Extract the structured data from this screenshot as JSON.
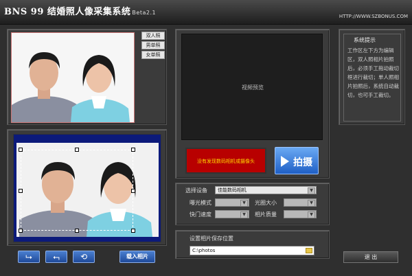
{
  "app": {
    "title": "BNS 99 结婚照人像采集系统",
    "version": "Beta2.1",
    "url": "HTTP://WWW.SZBONUS.COM"
  },
  "photo_tabs": [
    "双人照",
    "男单照",
    "女单照"
  ],
  "video": {
    "preview_label": "视频预览",
    "warning": "没有发现数码相机或摄像头",
    "shoot_label": "拍摄"
  },
  "settings": {
    "device_label": "选择设备",
    "device_value": "佳能数码相机",
    "exposure_label": "曝光模式",
    "aperture_label": "光圈大小",
    "shutter_label": "快门速度",
    "quality_label": "相片质量"
  },
  "save": {
    "label": "设置相片保存位置",
    "path": "C:\\photos"
  },
  "tips": {
    "title": "系统提示",
    "text": "工作区左下方为编辑区，双人照相片拍照后，必须手工拖动裁切框进行裁切；单人照相片拍照后，系统自动裁切，也可手工裁切。"
  },
  "controls": {
    "import_label": "载入相片",
    "exit_label": "退 出"
  },
  "colors": {
    "accent_blue": "#1f4a9a",
    "warning_red": "#b80000",
    "edit_frame_blue": "#0c1a7a"
  }
}
